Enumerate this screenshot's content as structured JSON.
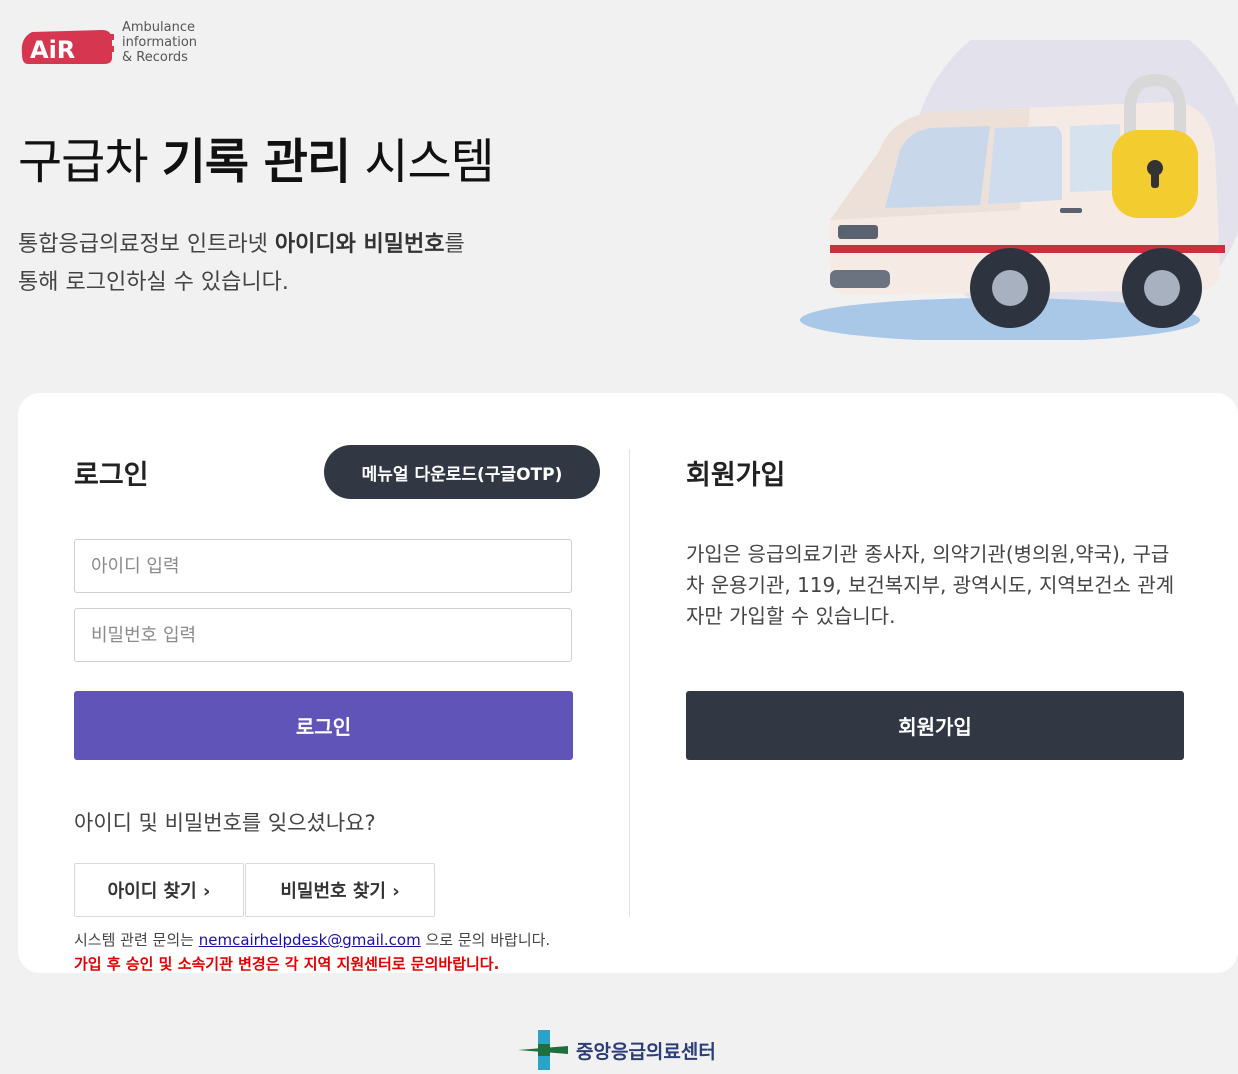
{
  "logo": {
    "badge": "AiR",
    "line1": "Ambulance",
    "line2": "information",
    "line3": "& Records"
  },
  "hero": {
    "title_part1": "구급차 ",
    "title_bold": "기록 관리",
    "title_part2": " 시스템",
    "desc_line1_plain": "통합응급의료정보 인트라넷 ",
    "desc_line1_bold": "아이디와 비밀번호",
    "desc_line1_end": "를",
    "desc_line2": "통해 로그인하실 수 있습니다."
  },
  "login": {
    "title": "로그인",
    "manual_button": "메뉴얼 다운로드(구글OTP)",
    "id_placeholder": "아이디 입력",
    "pw_placeholder": "비밀번호 입력",
    "submit_label": "로그인",
    "forgot_text": "아이디 및 비밀번호를 잊으셨나요?",
    "find_id_label": "아이디 찾기 ›",
    "find_pw_label": "비밀번호 찾기 ›",
    "contact_prefix": "시스템 관련 문의는 ",
    "contact_email": "nemcairhelpdesk@gmail.com",
    "contact_suffix": " 으로 문의 바랍니다.",
    "notice": "가입 후 승인 및 소속기관 변경은 각 지역 지원센터로 문의바랍니다."
  },
  "join": {
    "title": "회원가입",
    "description": "가입은 응급의료기관 종사자, 의약기관(병의원,약국), 구급차 운용기관, 119, 보건복지부, 광역시도, 지역보건소 관계자만 가입할 수 있습니다.",
    "button_label": "회원가입"
  },
  "footer": {
    "org_name": "중앙응급의료센터"
  },
  "colors": {
    "primary": "#6154b8",
    "dark": "#313743",
    "notice": "#e00000",
    "logo": "#d6364f"
  }
}
